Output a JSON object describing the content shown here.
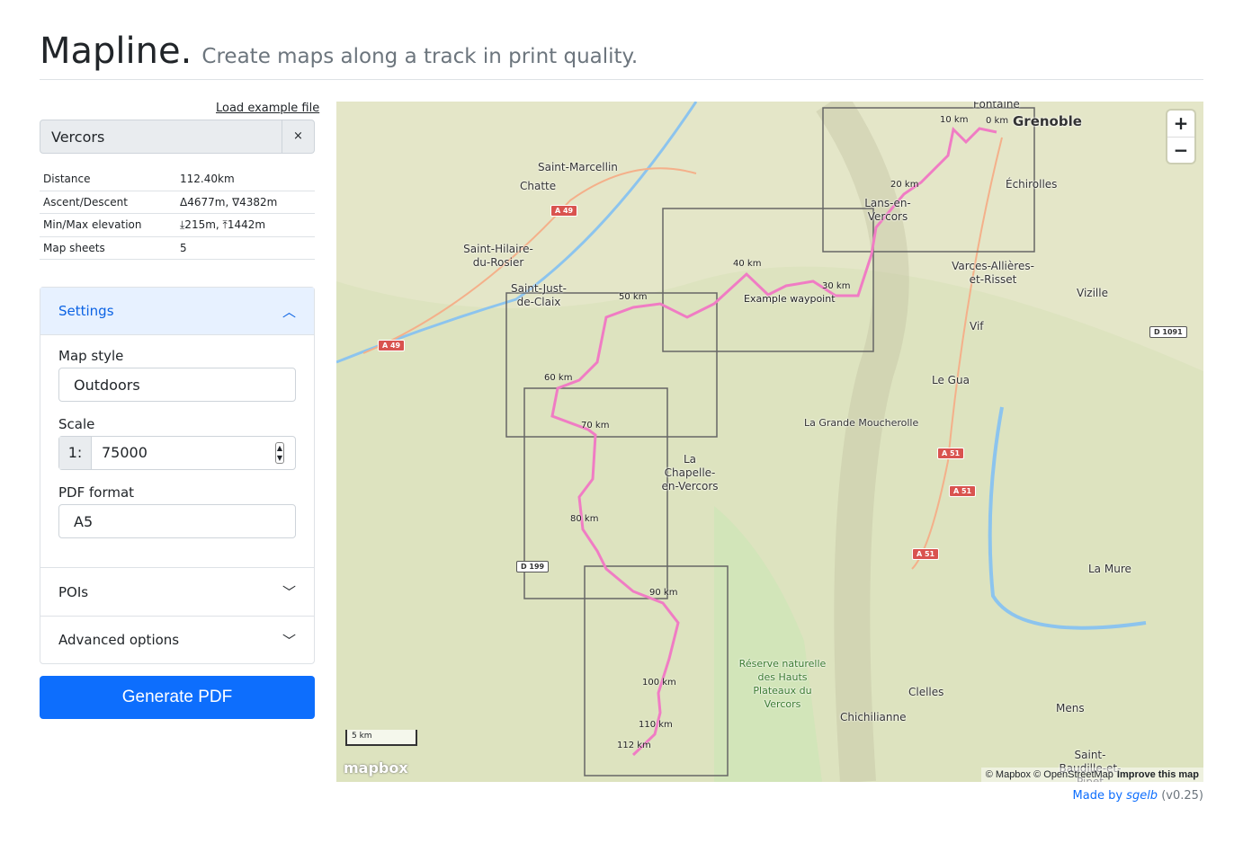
{
  "header": {
    "title": "Mapline.",
    "subtitle": "Create maps along a track in print quality."
  },
  "load_example": "Load example file",
  "file": {
    "name": "Vercors",
    "clear": "×"
  },
  "stats": [
    [
      "Distance",
      "112.40km"
    ],
    [
      "Ascent/Descent",
      "Δ4677m, ∇4382m"
    ],
    [
      "Min/Max elevation",
      "⤓215m, ⤒1442m"
    ],
    [
      "Map sheets",
      "5"
    ]
  ],
  "settings": {
    "title": "Settings",
    "map_style_label": "Map style",
    "map_style": "Outdoors",
    "scale_label": "Scale",
    "scale_prefix": "1:",
    "scale": "75000",
    "pdf_label": "PDF format",
    "pdf": "A5"
  },
  "pois": "POIs",
  "advanced": "Advanced options",
  "generate": "Generate PDF",
  "map": {
    "places": [
      "Fontaine",
      "Grenoble",
      "Échirolles",
      "Lans-en-Vercors",
      "Saint-Marcellin",
      "Chatte",
      "Saint-Hilaire-du-Rosier",
      "Saint-Just-de-Claix",
      "Varces-Allières-et-Risset",
      "Vizille",
      "Vif",
      "Le Gua",
      "La Grande Moucherolle",
      "La Chapelle-en-Vercors",
      "Réserve naturelle des Hauts Plateaux du Vercors",
      "Clelles",
      "Chichilianne",
      "Mens",
      "La Mure",
      "Saint-Baudille-et-Pipet",
      "Example waypoint"
    ],
    "roads": [
      "A 49",
      "A 49",
      "A 51",
      "A 51",
      "A 51",
      "D 1091",
      "D 199"
    ],
    "km_markers": [
      "0 km",
      "10 km",
      "20 km",
      "30 km",
      "40 km",
      "50 km",
      "60 km",
      "70 km",
      "80 km",
      "90 km",
      "100 km",
      "110 km",
      "112 km"
    ],
    "zoom_in": "+",
    "zoom_out": "−",
    "scale_bar": "5 km",
    "logo": "mapbox",
    "attribution": "© Mapbox © OpenStreetMap",
    "improve": "Improve this map",
    "track_color": "#f07cc4"
  },
  "footer": {
    "made_by": "Made by ",
    "author": "sgelb",
    "version": "(v0.25)"
  }
}
